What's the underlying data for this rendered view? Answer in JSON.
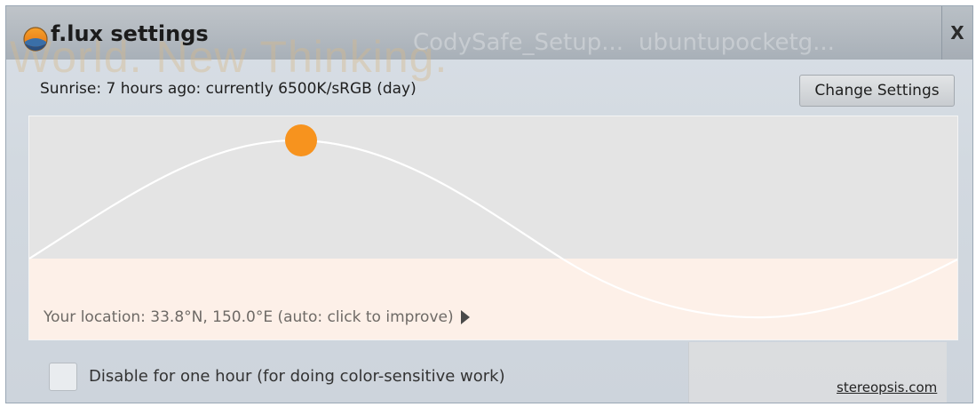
{
  "window": {
    "title": "f.lux settings",
    "close_label": "X"
  },
  "background_ghost": {
    "slogan": "World. New Thinking.",
    "taskbar_items": [
      "CodySafe_Setup...",
      "ubuntupocketg..."
    ]
  },
  "status": {
    "text": "Sunrise: 7 hours ago: currently 6500K/sRGB (day)"
  },
  "buttons": {
    "change_settings": "Change Settings"
  },
  "graph": {
    "location_text": "Your location: 33.8°N, 150.0°E (auto: click to improve)",
    "sun_color": "#f7931e",
    "day_color": "#e4e4e4",
    "night_color": "#fdf0e8"
  },
  "options": {
    "disable_label": "Disable for one hour (for doing color-sensitive work)",
    "disable_checked": false
  },
  "footer": {
    "link_text": "stereopsis.com"
  },
  "icons": {
    "app": "flux-logo-icon",
    "close": "close-icon",
    "location_arrow": "play-arrow-icon"
  }
}
